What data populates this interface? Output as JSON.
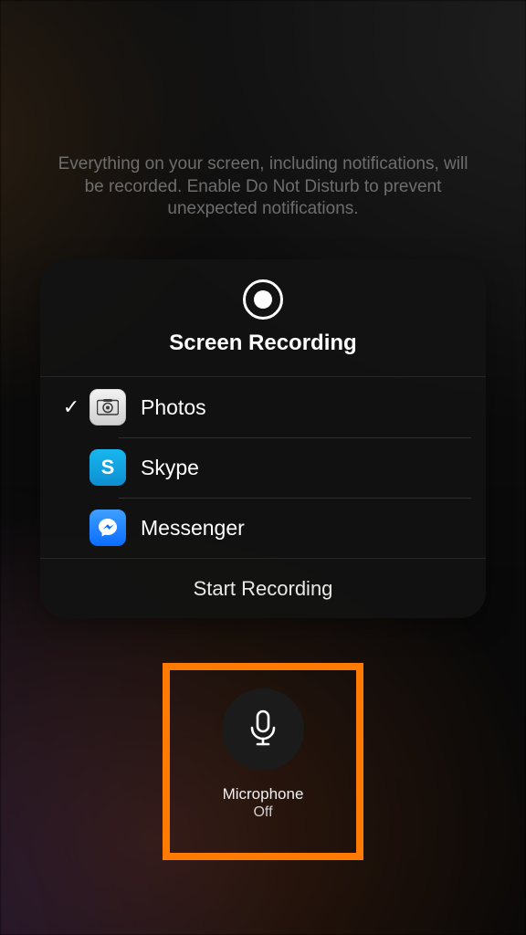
{
  "hint": "Everything on your screen, including notifications, will be recorded. Enable Do Not Disturb to prevent unexpected notifications.",
  "panel": {
    "title": "Screen Recording",
    "apps": [
      {
        "label": "Photos",
        "selected": true
      },
      {
        "label": "Skype",
        "selected": false
      },
      {
        "label": "Messenger",
        "selected": false
      }
    ],
    "start_label": "Start Recording"
  },
  "microphone": {
    "label": "Microphone",
    "status": "Off"
  },
  "highlight_color": "#ff7a00"
}
